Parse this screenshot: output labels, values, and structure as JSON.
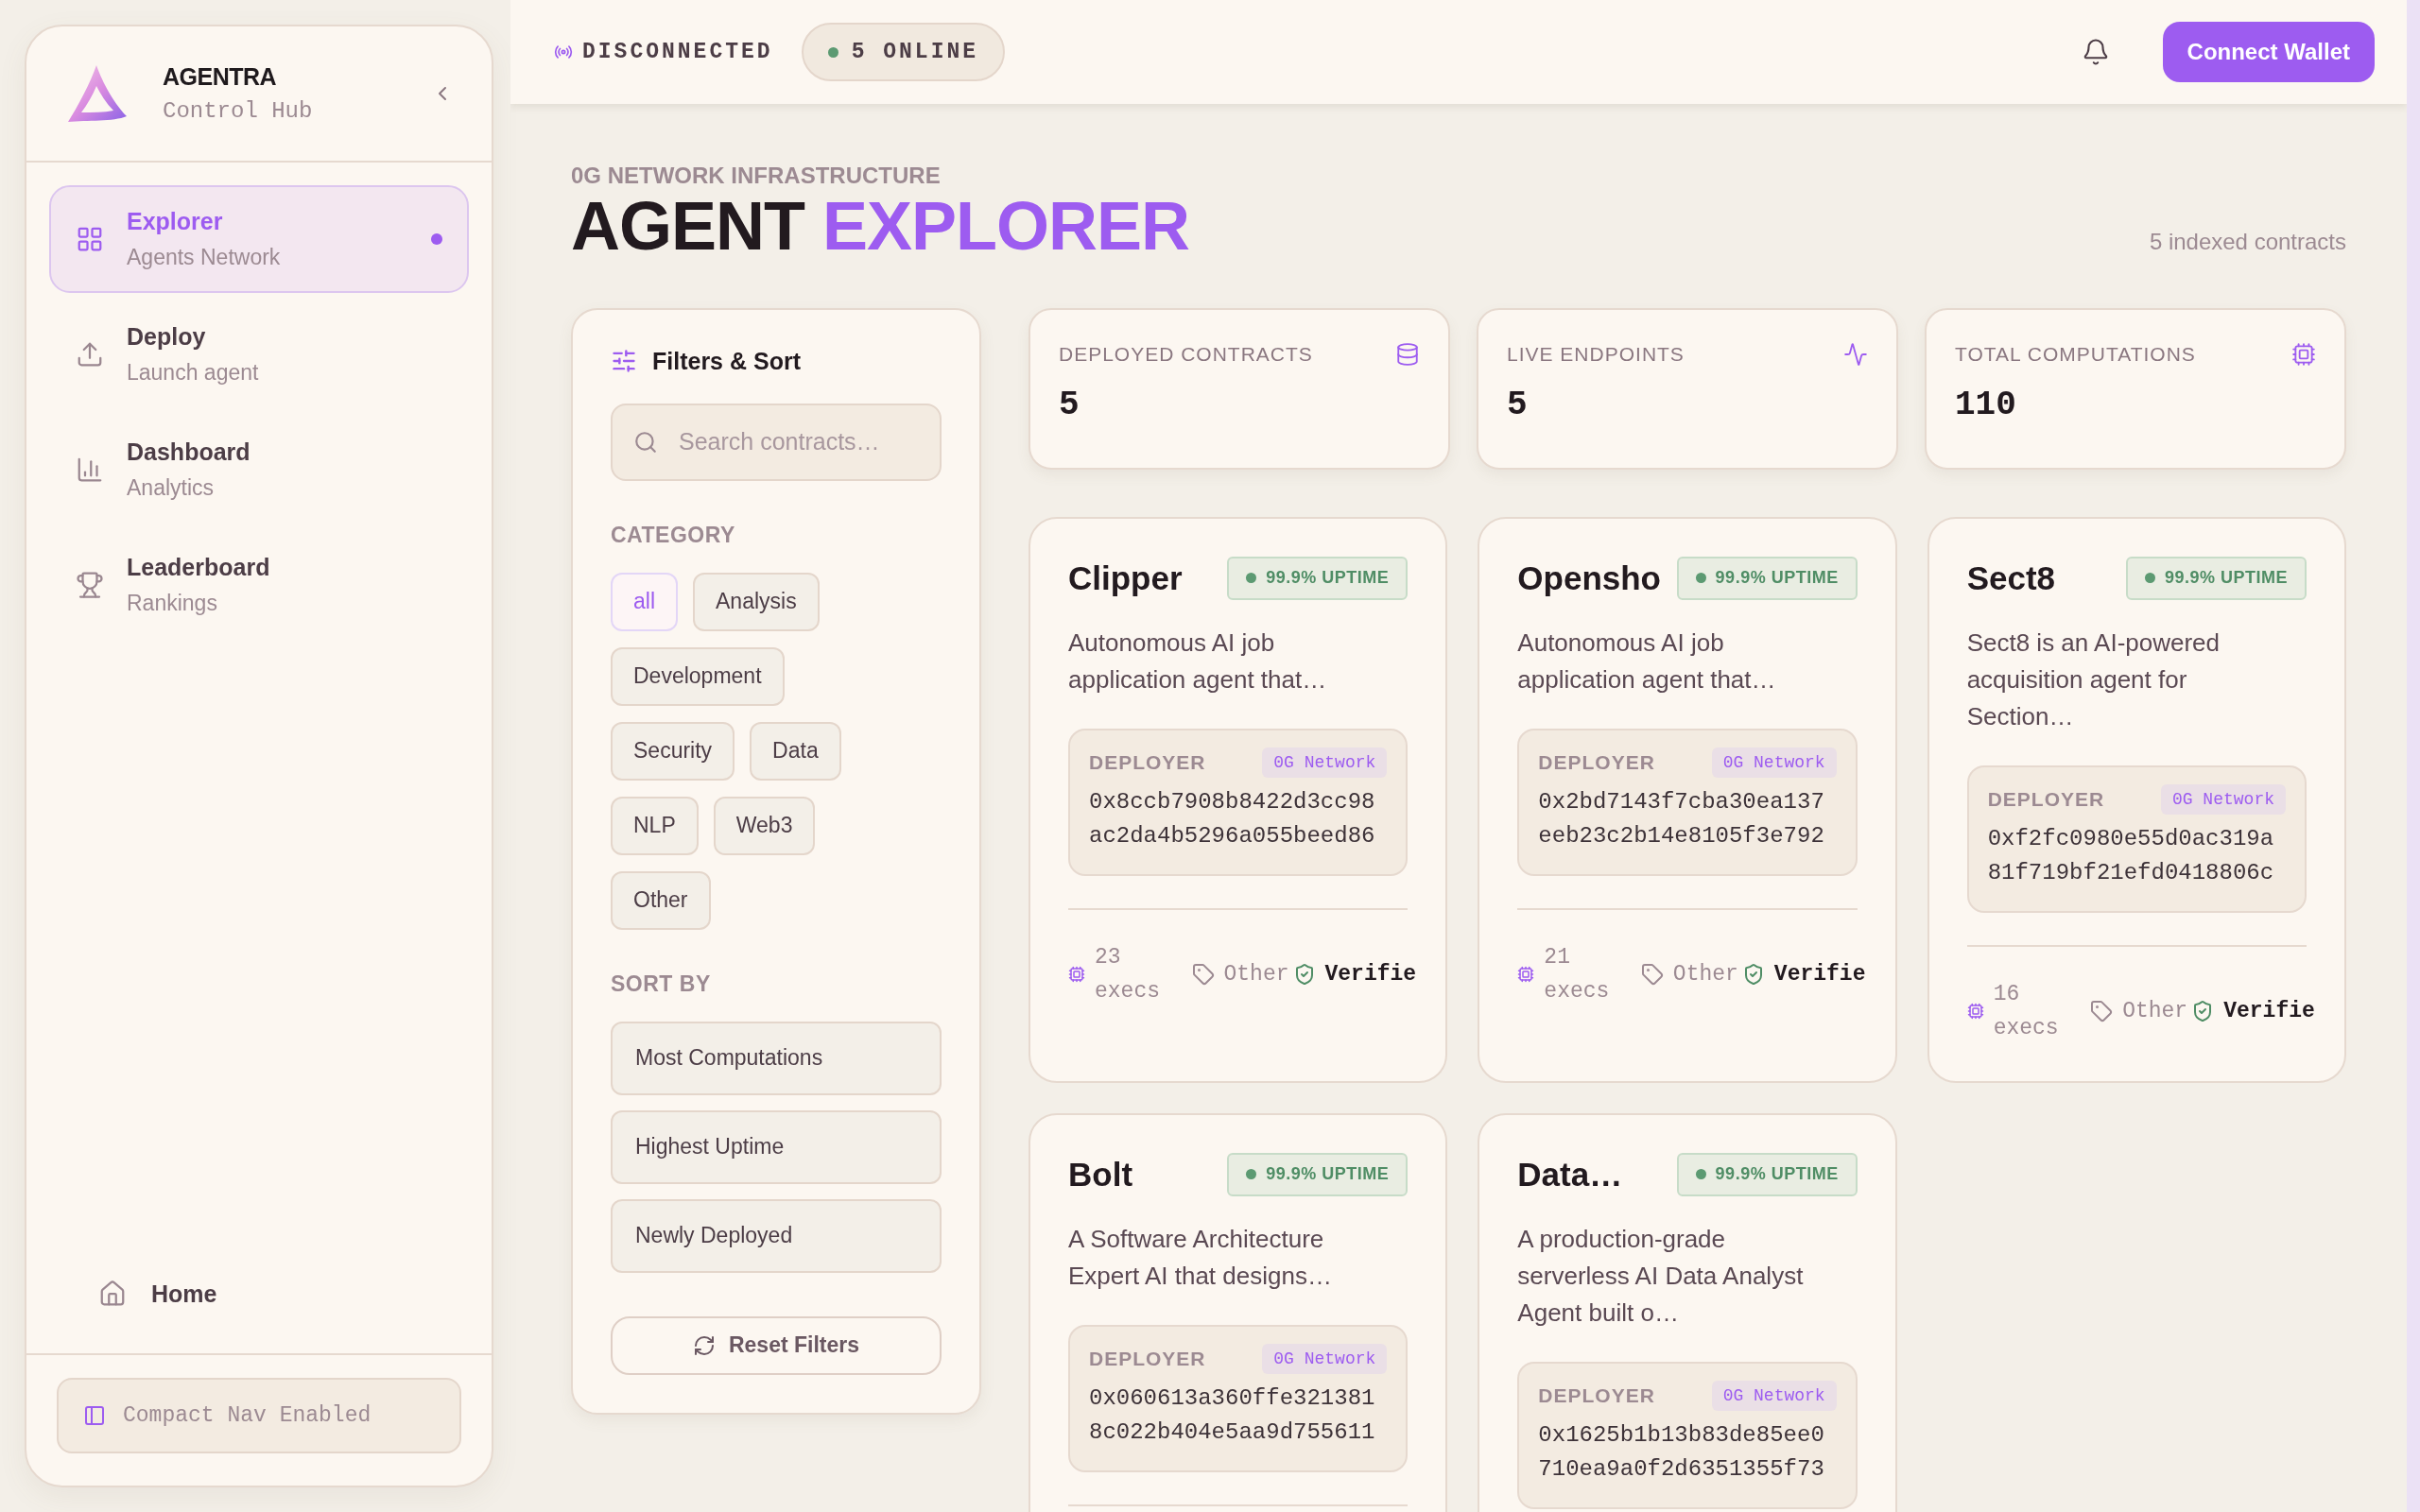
{
  "sidebar": {
    "brand": {
      "name": "AGENTRA",
      "subtitle": "Control Hub"
    },
    "nav_items": [
      {
        "label": "Explorer",
        "sublabel": "Agents Network",
        "selected": true
      },
      {
        "label": "Deploy",
        "sublabel": "Launch agent",
        "selected": false
      },
      {
        "label": "Dashboard",
        "sublabel": "Analytics",
        "selected": false
      },
      {
        "label": "Leaderboard",
        "sublabel": "Rankings",
        "selected": false
      }
    ],
    "home_item": {
      "label": "Home"
    },
    "compact_nav": {
      "label": "Compact Nav Enabled"
    }
  },
  "top_bar": {
    "connection": "DISCONNECTED",
    "online": "5 ONLINE",
    "connect_button": "Connect Wallet"
  },
  "header": {
    "eyebrow": "0G NETWORK INFRASTRUCTURE",
    "title_dark": "AGENT",
    "title_accent": "EXPLORER",
    "count": "5 indexed contracts"
  },
  "filters": {
    "title": "Filters & Sort",
    "search": {
      "placeholder": "Search contracts…"
    },
    "category_label": "CATEGORY",
    "categories": [
      {
        "label": "all",
        "selected": true
      },
      {
        "label": "Analysis",
        "selected": false
      },
      {
        "label": "Development",
        "selected": false
      },
      {
        "label": "Security",
        "selected": false
      },
      {
        "label": "Data",
        "selected": false
      },
      {
        "label": "NLP",
        "selected": false
      },
      {
        "label": "Web3",
        "selected": false
      },
      {
        "label": "Other",
        "selected": false
      }
    ],
    "sort_label": "SORT BY",
    "sort_options": [
      {
        "label": "Most Computations",
        "selected": false
      },
      {
        "label": "Highest Uptime",
        "selected": false
      },
      {
        "label": "Newly Deployed",
        "selected": false
      }
    ],
    "reset_button": "Reset Filters"
  },
  "stats": [
    {
      "label": "DEPLOYED CONTRACTS",
      "value": "5"
    },
    {
      "label": "LIVE ENDPOINTS",
      "value": "5"
    },
    {
      "label": "TOTAL COMPUTATIONS",
      "value": "110"
    }
  ],
  "agents": [
    {
      "name": "Clipper",
      "uptime": "99.9% UPTIME",
      "description": "Autonomous AI job application agent that…",
      "deployer_label": "DEPLOYER",
      "network": "0G Network",
      "address": "0x8ccb7908b8422d3cc98ac2da4b5296a055beed86",
      "execs": "23",
      "execs_unit": "execs",
      "category": "Other",
      "verified": "Verifie"
    },
    {
      "name": "Opensho",
      "uptime": "99.9% UPTIME",
      "description": "Autonomous AI job application agent that…",
      "deployer_label": "DEPLOYER",
      "network": "0G Network",
      "address": "0x2bd7143f7cba30ea137eeb23c2b14e8105f3e792",
      "execs": "21",
      "execs_unit": "execs",
      "category": "Other",
      "verified": "Verifie"
    },
    {
      "name": "Sect8",
      "uptime": "99.9% UPTIME",
      "description": "Sect8 is an AI-powered acquisition agent for Section…",
      "deployer_label": "DEPLOYER",
      "network": "0G Network",
      "address": "0xf2fc0980e55d0ac319a81f719bf21efd0418806c",
      "execs": "16",
      "execs_unit": "execs",
      "category": "Other",
      "verified": "Verifie"
    },
    {
      "name": "Bolt",
      "uptime": "99.9% UPTIME",
      "description": "A Software Architecture Expert AI that designs…",
      "deployer_label": "DEPLOYER",
      "network": "0G Network",
      "address": "0x060613a360ffe3213818c022b404e5aa9d755611"
    },
    {
      "name": "Data…",
      "uptime": "99.9% UPTIME",
      "description": "A production-grade serverless AI Data Analyst Agent built o…",
      "deployer_label": "DEPLOYER",
      "network": "0G Network",
      "address": "0x1625b1b13b83de85ee0710ea9a0f2d6351355f73"
    }
  ]
}
